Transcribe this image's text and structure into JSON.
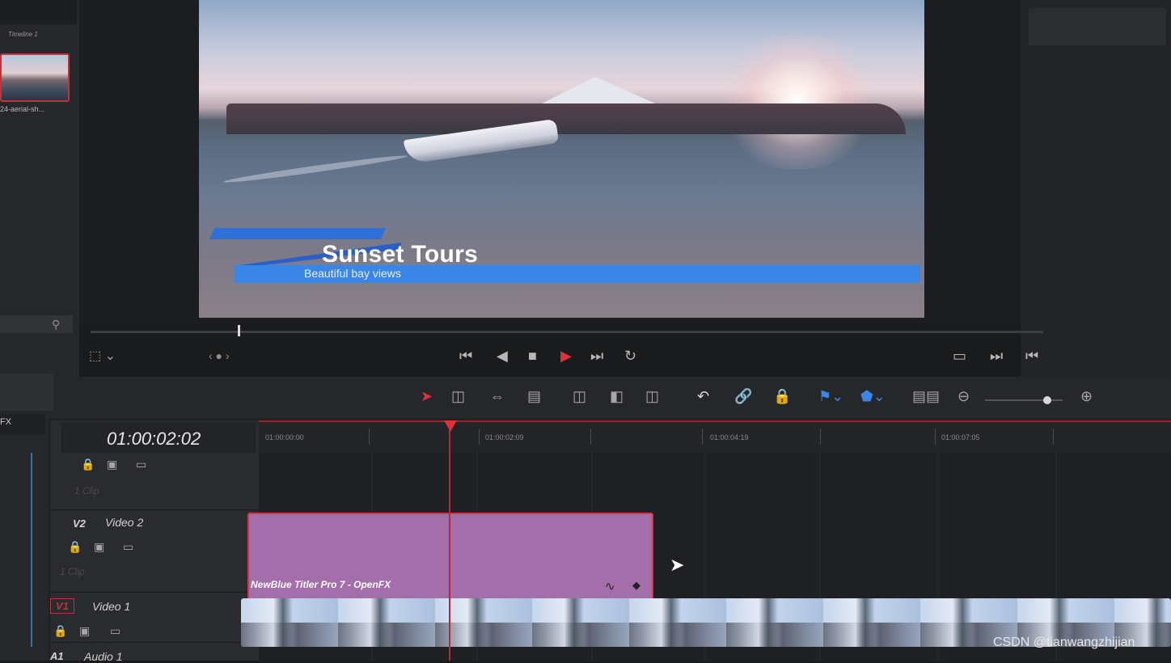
{
  "media_pool": {
    "timeline_label": "Timeline 1",
    "clip_name": "24-aerial-sh..."
  },
  "left_panel": {
    "fx_label": "FX"
  },
  "viewer": {
    "title": "Sunset Tours",
    "subtitle": "Beautiful bay views"
  },
  "timeline": {
    "timecode": "01:00:02:02",
    "ruler_labels": [
      "01:00:00:00",
      "01:00:02:09",
      "01:00:04:19",
      "01:00:07:05"
    ],
    "tracks": [
      {
        "tag": "",
        "name": "",
        "clip_count": "1 Clip"
      },
      {
        "tag": "V2",
        "name": "Video 2",
        "clip_count": "1 Clip"
      },
      {
        "tag": "V1",
        "name": "Video 1"
      },
      {
        "tag": "A1",
        "name": "Audio 1"
      }
    ],
    "titler_clip_label": "NewBlue Titler Pro 7 - OpenFX"
  },
  "colors": {
    "playhead": "#e0313b",
    "titler_clip": "#a46eaa",
    "lower_third_blue": "#3a86e6"
  },
  "icons": {
    "transport": [
      "skip-back-icon",
      "step-back-icon",
      "stop-icon",
      "play-icon",
      "skip-forward-icon",
      "loop-icon"
    ],
    "toolbar": [
      "selection-arrow-icon",
      "trim-edit-icon",
      "dynamic-trim-icon",
      "blade-icon",
      "insert-clip-icon",
      "overwrite-clip-icon",
      "replace-clip-icon",
      "snapping-icon",
      "linked-selection-icon",
      "lock-icon",
      "flag-icon",
      "marker-icon",
      "timeline-view-icon",
      "zoom-out-icon",
      "zoom-in-icon"
    ]
  },
  "watermark": "CSDN @tianwangzhijian"
}
